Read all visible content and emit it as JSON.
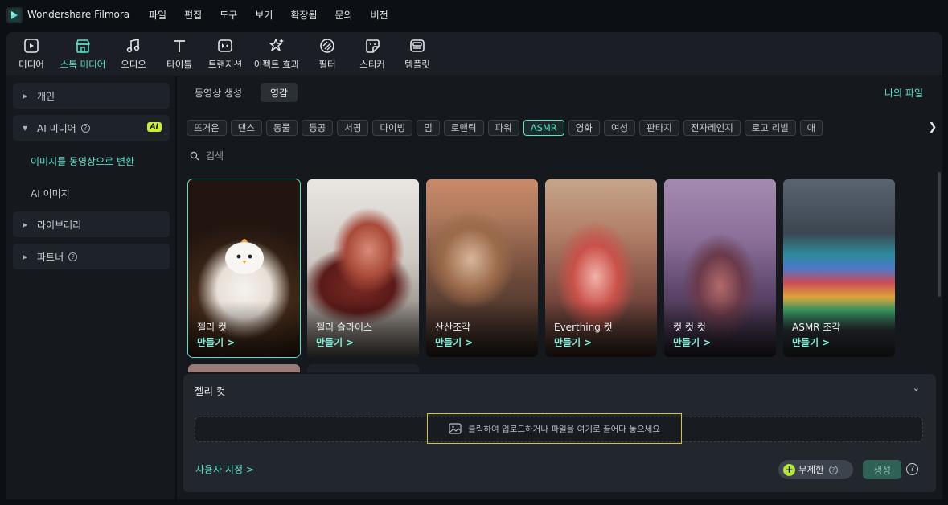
{
  "app": {
    "title": "Wondershare Filmora"
  },
  "menu": [
    "파일",
    "편집",
    "도구",
    "보기",
    "확장됨",
    "문의",
    "버전"
  ],
  "toolbar": [
    {
      "label": "미디어",
      "icon": "media-icon"
    },
    {
      "label": "스톡 미디어",
      "icon": "stock-media-icon",
      "active": true
    },
    {
      "label": "오디오",
      "icon": "audio-icon"
    },
    {
      "label": "타이틀",
      "icon": "titles-icon"
    },
    {
      "label": "트랜지션",
      "icon": "transition-icon"
    },
    {
      "label": "이펙트 효과",
      "icon": "effects-icon"
    },
    {
      "label": "필터",
      "icon": "filter-icon"
    },
    {
      "label": "스티커",
      "icon": "sticker-icon"
    },
    {
      "label": "템플릿",
      "icon": "template-icon"
    }
  ],
  "sidebar": {
    "personal": "개인",
    "ai_media": "AI 미디어",
    "ai_badge": "AI",
    "image_to_video": "이미지를 동영상으로 변환",
    "ai_image": "AI 이미지",
    "library": "라이브러리",
    "partner": "파트너"
  },
  "main": {
    "tabs": [
      "동영상 생성",
      "영감"
    ],
    "active_tab": "영감",
    "my_files": "나의 파일",
    "tags": [
      "뜨거운",
      "댄스",
      "동물",
      "등공",
      "서핑",
      "다이빙",
      "밈",
      "로맨틱",
      "파워",
      "ASMR",
      "영화",
      "여성",
      "판타지",
      "전자레인지",
      "로고 리빌",
      "애"
    ],
    "active_tag": "ASMR",
    "search_placeholder": "검색",
    "cards": [
      {
        "title": "젤리 컷",
        "action": "만들기 >"
      },
      {
        "title": "젤리 슬라이스",
        "action": "만들기 >"
      },
      {
        "title": "산산조각",
        "action": "만들기 >"
      },
      {
        "title": "Everthing 컷",
        "action": "만들기 >"
      },
      {
        "title": "컷 컷 컷",
        "action": "만들기 >"
      },
      {
        "title": "ASMR 조각",
        "action": "만들기 >"
      }
    ]
  },
  "panel": {
    "title": "젤리 컷",
    "upload_text": "클릭하여 업로드하거나 파일을 여기로 끌어다 놓으세요",
    "custom": "사용자 지정 >",
    "unlimited": "무제한",
    "generate": "생성"
  },
  "colors": {
    "accent": "#5fe0c8",
    "highlight": "#d8c23a",
    "ai_badge": "#c9ef3a"
  }
}
